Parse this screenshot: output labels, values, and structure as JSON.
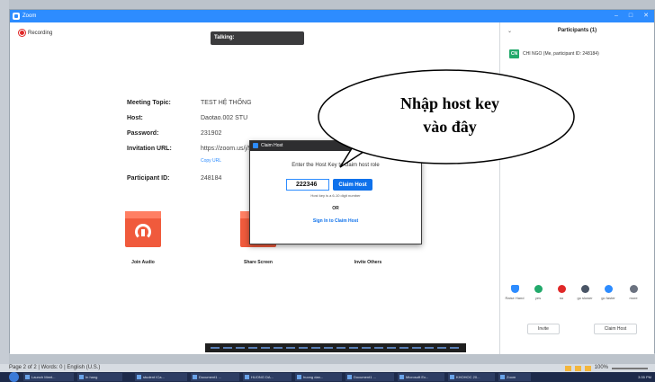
{
  "window": {
    "title": "Zoom"
  },
  "recording": {
    "label": "Recording"
  },
  "talking": {
    "label": "Talking:"
  },
  "meeting": {
    "topic_label": "Meeting Topic:",
    "topic": "TEST HỆ THỐNG",
    "host_label": "Host:",
    "host": "Daotao.002 STU",
    "password_label": "Password:",
    "password": "231902",
    "url_label": "Invitation URL:",
    "url": "https://zoom.us/j/506928822?pwd=OWRe",
    "copy_url": "Copy URL",
    "participant_id_label": "Participant ID:",
    "participant_id": "248184"
  },
  "actions": [
    {
      "label": "Join Audio"
    },
    {
      "label": "Share Screen"
    },
    {
      "label": "Invite Others"
    }
  ],
  "dialog": {
    "title": "Claim Host",
    "prompt": "Enter the Host Key to claim host role",
    "host_key": "222346",
    "claim_button": "Claim Host",
    "hint": "Host key is a 6-10 digit number",
    "or": "OR",
    "sign_in": "Sign In to Claim Host"
  },
  "callout": {
    "line1": "Nhập host key",
    "line2": "vào đây"
  },
  "participants": {
    "header": "Participants (1)",
    "items": [
      {
        "initials": "CN",
        "name": "CHI NGO (Me, participant ID: 248184)"
      }
    ],
    "controls": [
      {
        "label": "Raise Hand",
        "color": "#2d8cff"
      },
      {
        "label": "yes",
        "color": "#22a96b"
      },
      {
        "label": "no",
        "color": "#e02828"
      },
      {
        "label": "go slower",
        "color": "#4a5566"
      },
      {
        "label": "go faster",
        "color": "#2d8cff"
      },
      {
        "label": "more",
        "color": "#6b7280"
      }
    ],
    "invite_button": "Invite",
    "claim_host_button": "Claim Host"
  },
  "word_status": {
    "text": "Page 2 of 2 | Words: 0 | English (U.S.)",
    "zoom": "100%"
  },
  "taskbar": {
    "items": [
      "Launch Meet...",
      "In hang",
      "student ICa...",
      "Document1 ...",
      "HUONG DA...",
      "huong dan...",
      "Document1 ...",
      "Microsoft Ex...",
      "KHOHOC 20...",
      "Zoom"
    ],
    "clock": "3:35 PM"
  }
}
